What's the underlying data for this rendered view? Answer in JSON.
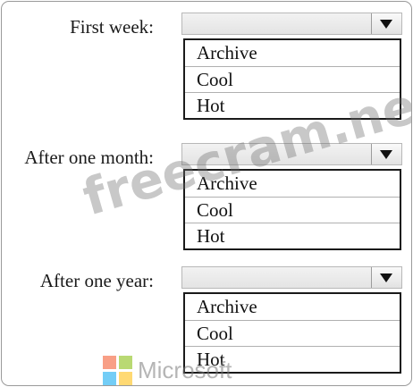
{
  "questions": [
    {
      "label": "First week:",
      "options": [
        "Archive",
        "Cool",
        "Hot"
      ]
    },
    {
      "label": "After one month:",
      "options": [
        "Archive",
        "Cool",
        "Hot"
      ]
    },
    {
      "label": "After one year:",
      "options": [
        "Archive",
        "Cool",
        "Hot"
      ]
    }
  ],
  "watermark": {
    "text": "freecram.net"
  },
  "brand_logo": {
    "text": "Microsoft",
    "colors": [
      "#f25022",
      "#7fba00",
      "#00a4ef",
      "#ffb900"
    ]
  }
}
